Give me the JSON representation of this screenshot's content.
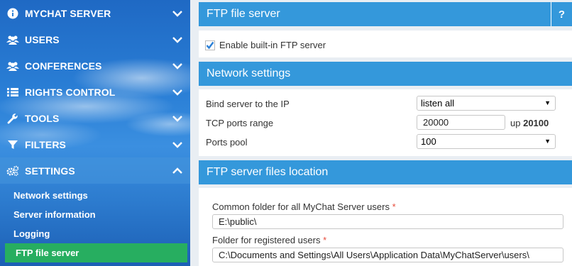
{
  "sidebar": {
    "items": [
      {
        "label": "MYCHAT SERVER",
        "icon": "info-icon"
      },
      {
        "label": "USERS",
        "icon": "users-icon"
      },
      {
        "label": "CONFERENCES",
        "icon": "conferences-icon"
      },
      {
        "label": "RIGHTS CONTROL",
        "icon": "list-icon"
      },
      {
        "label": "TOOLS",
        "icon": "wrench-icon"
      },
      {
        "label": "FILTERS",
        "icon": "filter-icon"
      },
      {
        "label": "SETTINGS",
        "icon": "gears-icon"
      }
    ],
    "sub_items": [
      {
        "label": "Network settings"
      },
      {
        "label": "Server information"
      },
      {
        "label": "Logging"
      },
      {
        "label": "FTP file server"
      }
    ],
    "active_color": "#27ae60"
  },
  "ftp": {
    "title": "FTP file server",
    "help": "?",
    "enable_label": "Enable built-in FTP server",
    "enabled": true
  },
  "network": {
    "title": "Network settings",
    "bind_label": "Bind server to the IP",
    "bind_value": "listen all",
    "ports_label": "TCP ports range",
    "ports_from": "20000",
    "ports_up_label": "up",
    "ports_to": "20100",
    "pool_label": "Ports pool",
    "pool_value": "100"
  },
  "location": {
    "title": "FTP server files location",
    "common_label": "Common folder for all MyChat Server users",
    "common_value": "E:\\public\\",
    "registered_label": "Folder for registered users",
    "registered_value": "C:\\Documents and Settings\\All Users\\Application Data\\MyChatServer\\users\\",
    "required_mark": "*"
  },
  "colors": {
    "header_blue": "#3498db",
    "sidebar_blue": "#2a7fd6",
    "required": "#e74c3c"
  }
}
